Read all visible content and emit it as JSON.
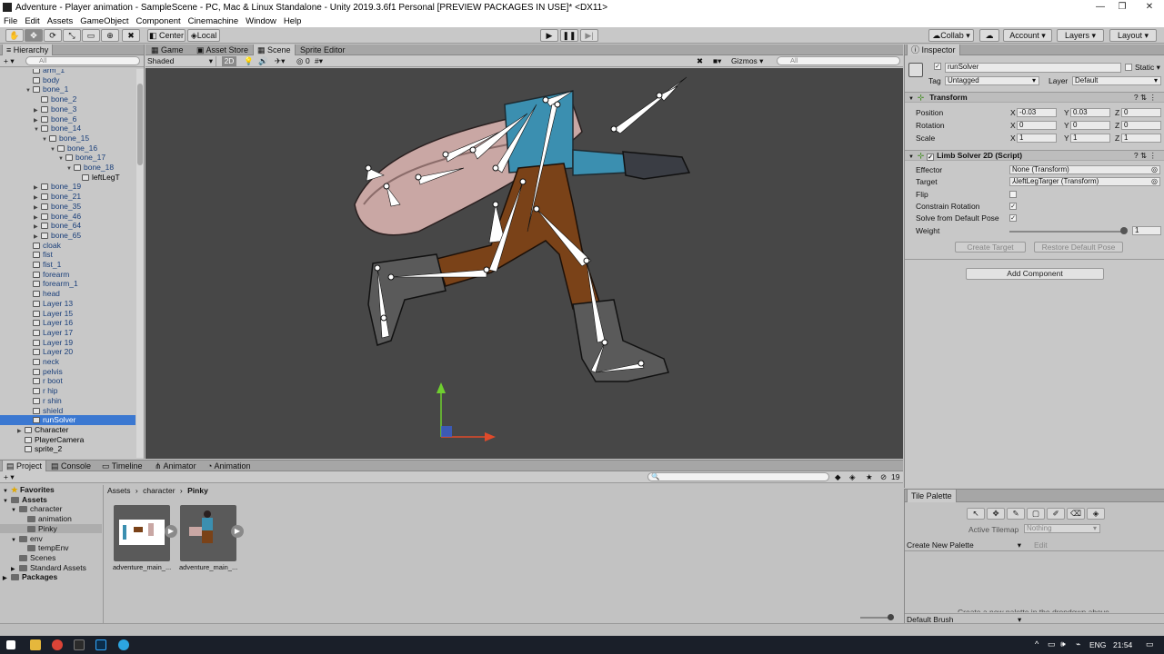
{
  "window": {
    "title": "Adventure - Player animation - SampleScene - PC, Mac & Linux Standalone - Unity 2019.3.6f1 Personal [PREVIEW PACKAGES IN USE]* <DX11>",
    "controls": [
      "—",
      "❐",
      "✕"
    ]
  },
  "menu": [
    "File",
    "Edit",
    "Assets",
    "GameObject",
    "Component",
    "Cinemachine",
    "Window",
    "Help"
  ],
  "toolbar": {
    "pivot": "Center",
    "space": "Local",
    "collab": "Collab",
    "account": "Account",
    "layers": "Layers",
    "layout": "Layout"
  },
  "hierarchy": {
    "tab": "Hierarchy",
    "search_placeholder": "All",
    "rows": [
      {
        "label": "arm_1",
        "indent": 4,
        "arrow": ""
      },
      {
        "label": "body",
        "indent": 4,
        "arrow": ""
      },
      {
        "label": "bone_1",
        "indent": 4,
        "arrow": "▼"
      },
      {
        "label": "bone_2",
        "indent": 5,
        "arrow": ""
      },
      {
        "label": "bone_3",
        "indent": 5,
        "arrow": "▶"
      },
      {
        "label": "bone_6",
        "indent": 5,
        "arrow": "▶"
      },
      {
        "label": "bone_14",
        "indent": 5,
        "arrow": "▼"
      },
      {
        "label": "bone_15",
        "indent": 6,
        "arrow": "▼"
      },
      {
        "label": "bone_16",
        "indent": 7,
        "arrow": "▼"
      },
      {
        "label": "bone_17",
        "indent": 8,
        "arrow": "▼"
      },
      {
        "label": "bone_18",
        "indent": 9,
        "arrow": "▼"
      },
      {
        "label": "leftLegT",
        "indent": 10,
        "arrow": "",
        "black": true
      },
      {
        "label": "bone_19",
        "indent": 5,
        "arrow": "▶"
      },
      {
        "label": "bone_21",
        "indent": 5,
        "arrow": "▶"
      },
      {
        "label": "bone_35",
        "indent": 5,
        "arrow": "▶"
      },
      {
        "label": "bone_46",
        "indent": 5,
        "arrow": "▶"
      },
      {
        "label": "bone_64",
        "indent": 5,
        "arrow": "▶"
      },
      {
        "label": "bone_65",
        "indent": 5,
        "arrow": "▶"
      },
      {
        "label": "cloak",
        "indent": 4,
        "arrow": ""
      },
      {
        "label": "fist",
        "indent": 4,
        "arrow": ""
      },
      {
        "label": "fist_1",
        "indent": 4,
        "arrow": ""
      },
      {
        "label": "forearm",
        "indent": 4,
        "arrow": ""
      },
      {
        "label": "forearm_1",
        "indent": 4,
        "arrow": ""
      },
      {
        "label": "head",
        "indent": 4,
        "arrow": ""
      },
      {
        "label": "Layer 13",
        "indent": 4,
        "arrow": ""
      },
      {
        "label": "Layer 15",
        "indent": 4,
        "arrow": ""
      },
      {
        "label": "Layer 16",
        "indent": 4,
        "arrow": ""
      },
      {
        "label": "Layer 17",
        "indent": 4,
        "arrow": ""
      },
      {
        "label": "Layer 19",
        "indent": 4,
        "arrow": ""
      },
      {
        "label": "Layer 20",
        "indent": 4,
        "arrow": ""
      },
      {
        "label": "neck",
        "indent": 4,
        "arrow": ""
      },
      {
        "label": "pelvis",
        "indent": 4,
        "arrow": ""
      },
      {
        "label": "r boot",
        "indent": 4,
        "arrow": ""
      },
      {
        "label": "r hip",
        "indent": 4,
        "arrow": ""
      },
      {
        "label": "r shin",
        "indent": 4,
        "arrow": ""
      },
      {
        "label": "shield",
        "indent": 4,
        "arrow": ""
      },
      {
        "label": "runSolver",
        "indent": 4,
        "arrow": "",
        "selected": true
      },
      {
        "label": "Character",
        "indent": 3,
        "arrow": "▶",
        "black": true
      },
      {
        "label": "PlayerCamera",
        "indent": 3,
        "arrow": "",
        "black": true
      },
      {
        "label": "sprite_2",
        "indent": 3,
        "arrow": "",
        "black": true
      }
    ]
  },
  "scene_tabs": {
    "game": "Game",
    "asset_store": "Asset Store",
    "scene": "Scene",
    "sprite_editor": "Sprite Editor"
  },
  "scene_toolbar": {
    "shading": "Shaded",
    "mode_2d": "2D",
    "fx_count": "0",
    "gizmos": "Gizmos",
    "search_placeholder": "All"
  },
  "inspector": {
    "tab": "Inspector",
    "object_name": "runSolver",
    "static_label": "Static",
    "tag_label": "Tag",
    "tag_value": "Untagged",
    "layer_label": "Layer",
    "layer_value": "Default",
    "transform": {
      "title": "Transform",
      "position_label": "Position",
      "rotation_label": "Rotation",
      "scale_label": "Scale",
      "position": {
        "x": "-0.03",
        "y": "0.03",
        "z": "0"
      },
      "rotation": {
        "x": "0",
        "y": "0",
        "z": "0"
      },
      "scale": {
        "x": "1",
        "y": "1",
        "z": "1"
      }
    },
    "solver": {
      "title": "Limb Solver 2D (Script)",
      "effector_label": "Effector",
      "effector_value": "None (Transform)",
      "target_label": "Target",
      "target_value": "leftLegTarger (Transform)",
      "flip_label": "Flip",
      "flip": false,
      "constrain_label": "Constrain Rotation",
      "constrain": true,
      "solve_default_label": "Solve from Default Pose",
      "solve_default": true,
      "weight_label": "Weight",
      "weight_value": "1",
      "weight": 1,
      "create_target": "Create Target",
      "restore_pose": "Restore Default Pose"
    },
    "add_component": "Add Component"
  },
  "bottom_tabs": {
    "project": "Project",
    "console": "Console",
    "timeline": "Timeline",
    "animator": "Animator",
    "animation": "Animation"
  },
  "project": {
    "hidden_count": "19",
    "tree": [
      {
        "label": "Favorites",
        "indent": 0,
        "bold": true,
        "arrow": "▼",
        "star": true
      },
      {
        "label": "Assets",
        "indent": 0,
        "bold": true,
        "arrow": "▼"
      },
      {
        "label": "character",
        "indent": 1,
        "arrow": "▼"
      },
      {
        "label": "animation",
        "indent": 2,
        "arrow": ""
      },
      {
        "label": "Pinky",
        "indent": 2,
        "arrow": "",
        "selected": true
      },
      {
        "label": "env",
        "indent": 1,
        "arrow": "▼"
      },
      {
        "label": "tempEnv",
        "indent": 2,
        "arrow": ""
      },
      {
        "label": "Scenes",
        "indent": 1,
        "arrow": ""
      },
      {
        "label": "Standard Assets",
        "indent": 1,
        "arrow": "▶"
      },
      {
        "label": "Packages",
        "indent": 0,
        "bold": true,
        "arrow": "▶"
      }
    ],
    "breadcrumb": [
      "Assets",
      "character",
      "Pinky"
    ],
    "assets": [
      {
        "label": "adventure_main_..."
      },
      {
        "label": "adventure_main_..."
      }
    ]
  },
  "tile_palette": {
    "tab": "Tile Palette",
    "active_tilemap_label": "Active Tilemap",
    "active_tilemap_value": "Nothing",
    "create_palette": "Create New Palette",
    "edit": "Edit",
    "hint": "Create a new palette in the dropdown above.",
    "brush": "Default Brush"
  },
  "taskbar": {
    "lang": "ENG",
    "time": "21:54"
  }
}
